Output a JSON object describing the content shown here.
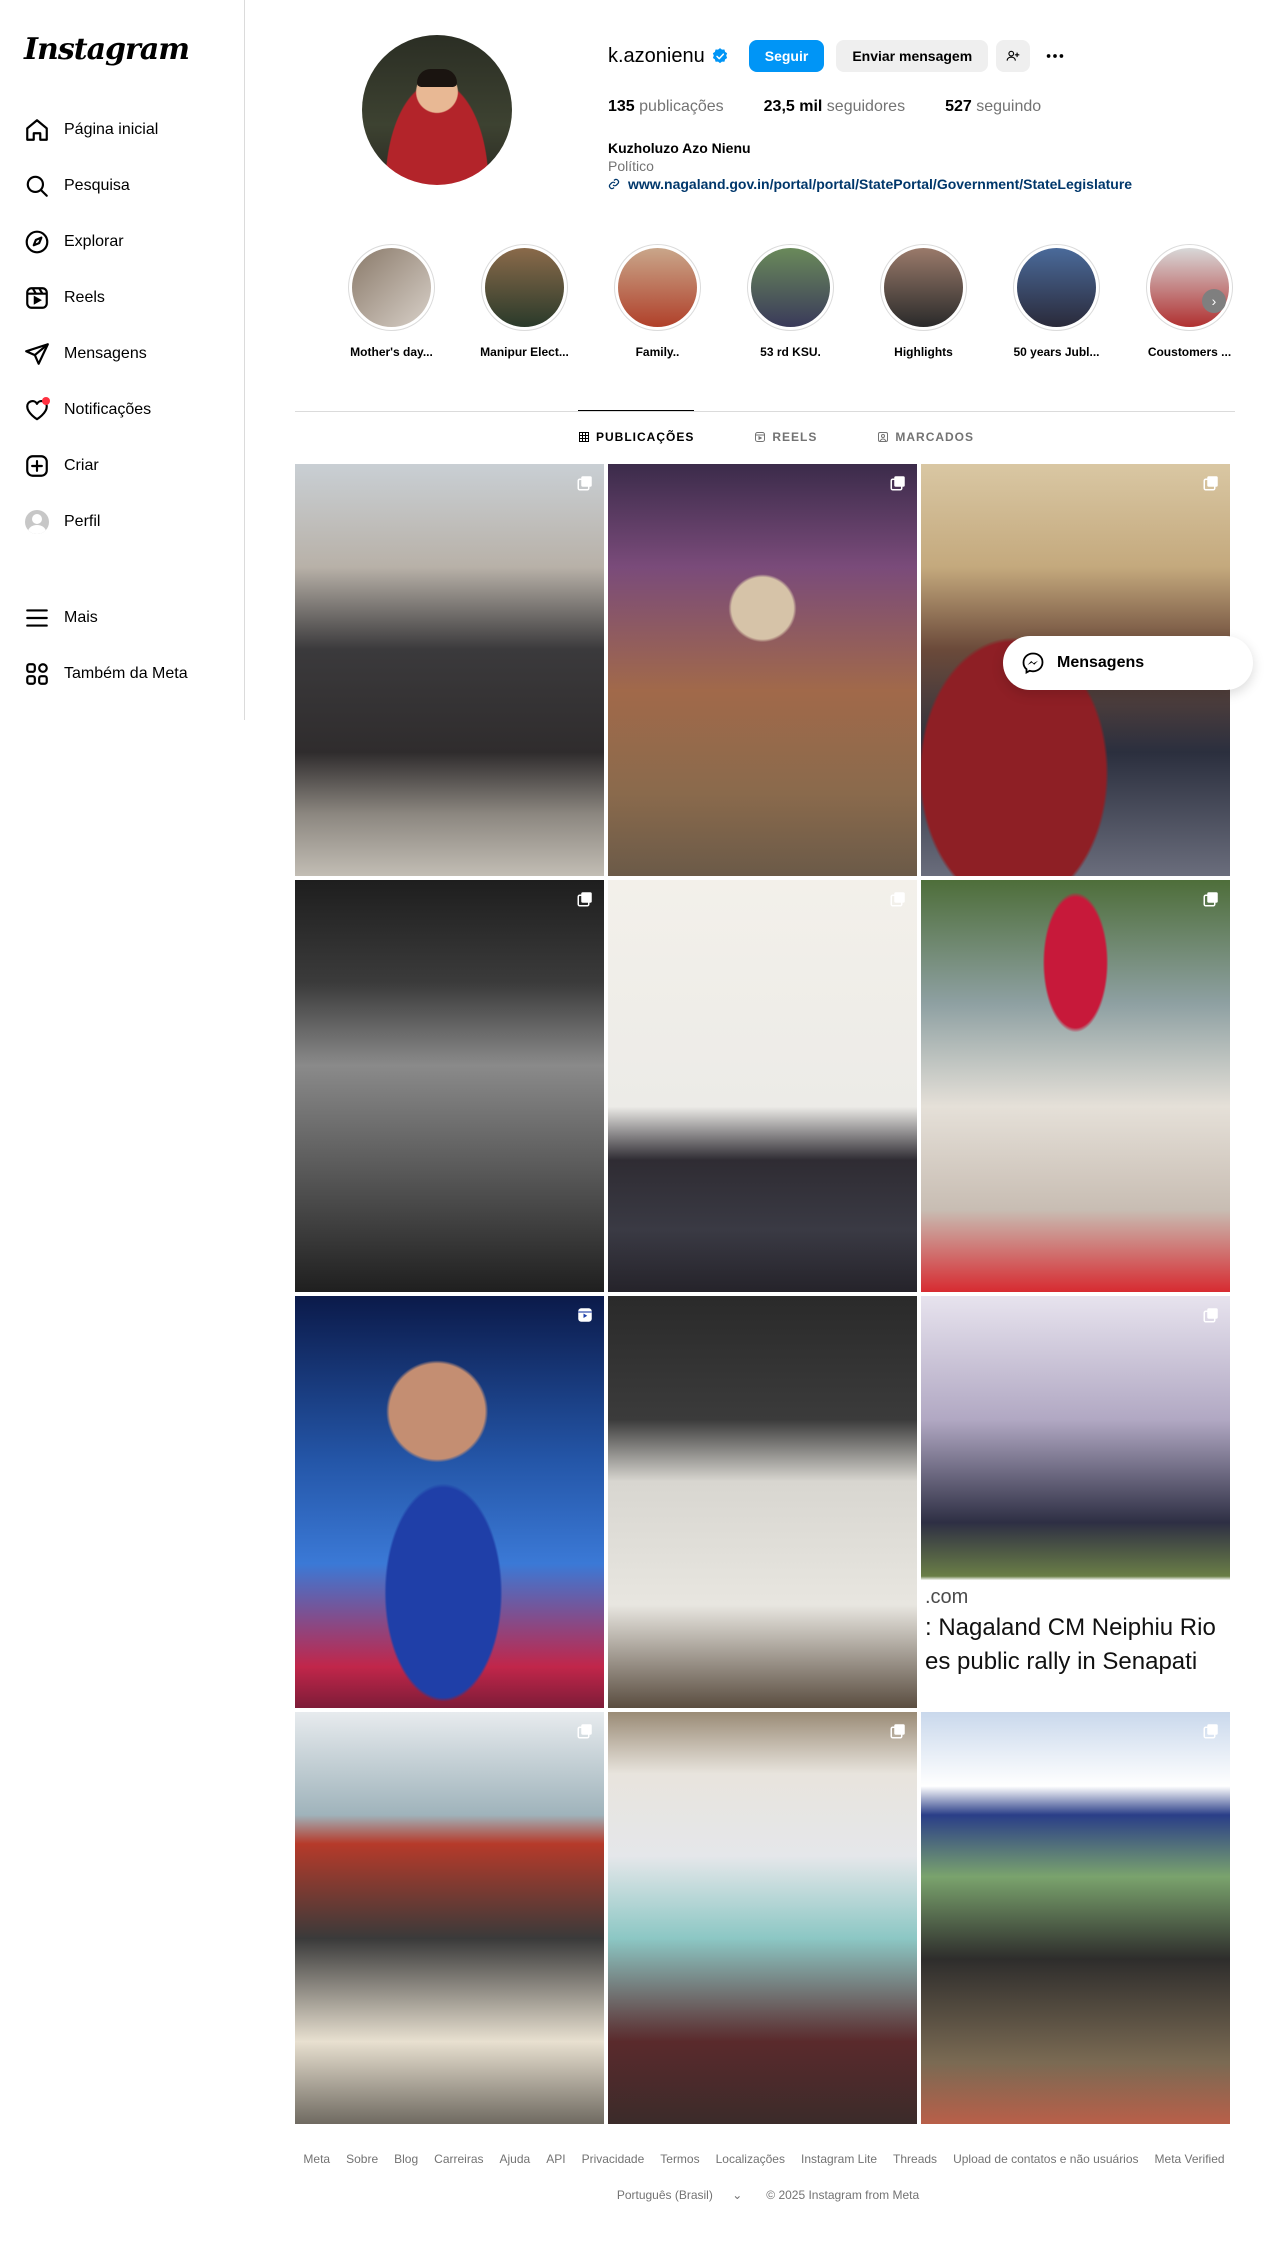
{
  "brand": {
    "logo": "Instagram"
  },
  "sidebar": {
    "items": [
      {
        "label": "Página inicial",
        "icon": "home-icon"
      },
      {
        "label": "Pesquisa",
        "icon": "search-icon"
      },
      {
        "label": "Explorar",
        "icon": "compass-icon"
      },
      {
        "label": "Reels",
        "icon": "reels-icon"
      },
      {
        "label": "Mensagens",
        "icon": "send-icon"
      },
      {
        "label": "Notificações",
        "icon": "heart-icon",
        "has_dot": true
      },
      {
        "label": "Criar",
        "icon": "plus-square-icon"
      },
      {
        "label": "Perfil",
        "icon": "avatar"
      }
    ],
    "bottom_items": [
      {
        "label": "Mais",
        "icon": "menu-icon"
      },
      {
        "label": "Também da Meta",
        "icon": "meta-apps-icon"
      }
    ]
  },
  "profile": {
    "username": "k.azonienu",
    "verified": true,
    "follow_label": "Seguir",
    "message_label": "Enviar mensagem",
    "stats": {
      "posts_count": "135",
      "posts_label": " publicações",
      "followers_count": "23,5 mil",
      "followers_label": " seguidores",
      "following_count": "527",
      "following_label": " seguindo"
    },
    "full_name": "Kuzholuzo Azo Nienu",
    "category": "Político",
    "link": "www.nagaland.gov.in/portal/portal/StatePortal/Government/StateLegislature"
  },
  "highlights": [
    {
      "label": "Mother's day...",
      "colors": [
        "#8a7a6a",
        "#d8d0c8"
      ]
    },
    {
      "label": "Manipur Elect...",
      "colors": [
        "#5a4a3a",
        "#2a3a2a"
      ]
    },
    {
      "label": "Family..",
      "colors": [
        "#c9a68a",
        "#b0402a"
      ]
    },
    {
      "label": "53 rd KSU.",
      "colors": [
        "#6a8a5a",
        "#3a3a5a"
      ]
    },
    {
      "label": "Highlights",
      "colors": [
        "#7a5a4a",
        "#2a2a2a"
      ]
    },
    {
      "label": "50 years Jubl...",
      "colors": [
        "#4a6a9a",
        "#2a2a3a"
      ]
    },
    {
      "label": "Coustomers ...",
      "colors": [
        "#b03030",
        "#d8d8d8"
      ]
    }
  ],
  "tabs": [
    {
      "label": "PUBLICAÇÕES",
      "icon": "grid-icon",
      "active": true
    },
    {
      "label": "REELS",
      "icon": "reels-icon",
      "active": false
    },
    {
      "label": "MARCADOS",
      "icon": "tagged-icon",
      "active": false
    }
  ],
  "posts": [
    {
      "badge": "carousel-icon"
    },
    {
      "badge": "carousel-icon"
    },
    {
      "badge": "carousel-icon"
    },
    {
      "badge": "carousel-icon"
    },
    {
      "badge": "carousel-icon"
    },
    {
      "badge": "carousel-icon"
    },
    {
      "badge": "reel-icon"
    },
    {
      "badge": "none"
    },
    {
      "badge": "carousel-icon",
      "overlay": [
        ".com",
        ": Nagaland CM Neiphiu Rio",
        "es public rally in Senapati"
      ]
    },
    {
      "badge": "carousel-icon"
    },
    {
      "badge": "carousel-icon"
    },
    {
      "badge": "carousel-icon"
    }
  ],
  "messages_pill": {
    "label": "Mensagens",
    "icon": "messenger-icon"
  },
  "footer": {
    "links": [
      "Meta",
      "Sobre",
      "Blog",
      "Carreiras",
      "Ajuda",
      "API",
      "Privacidade",
      "Termos",
      "Localizações",
      "Instagram Lite",
      "Threads",
      "Upload de contatos e não usuários",
      "Meta Verified"
    ],
    "language": "Português (Brasil)",
    "copyright": "© 2025 Instagram from Meta"
  },
  "colors": {
    "accent": "#0095f6",
    "link": "#00376b",
    "notification": "#ff3040"
  }
}
